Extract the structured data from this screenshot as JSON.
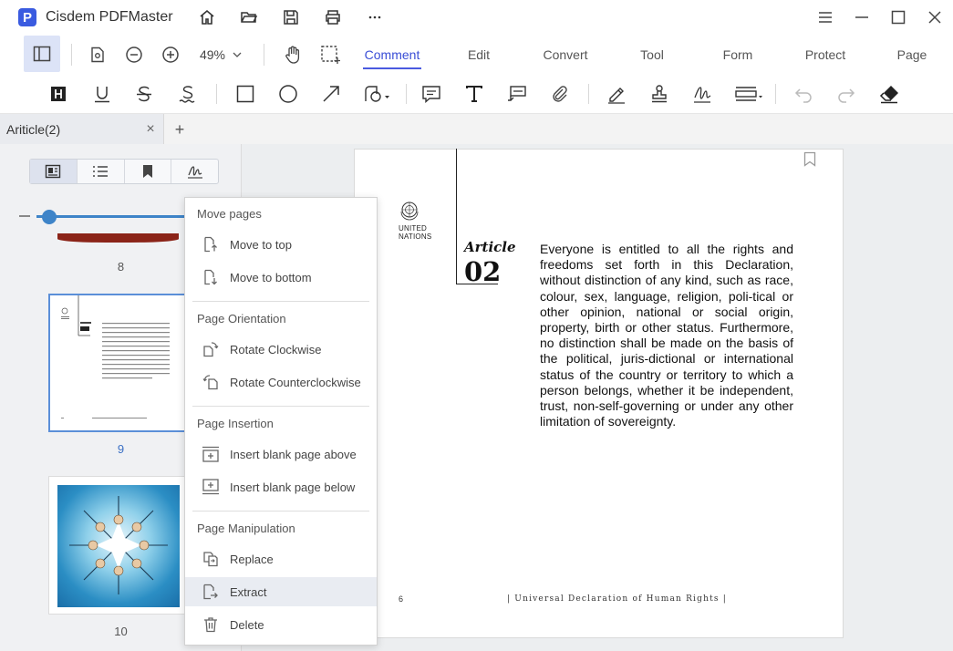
{
  "window": {
    "app_name": "Cisdem PDFMaster",
    "logo_letter": "P"
  },
  "titlebar_icons": [
    "home-icon",
    "open-folder-icon",
    "save-icon",
    "print-icon",
    "more-icon"
  ],
  "toolbar": {
    "zoom": "49%",
    "tabs": [
      {
        "label": "Comment",
        "active": true
      },
      {
        "label": "Edit",
        "active": false
      },
      {
        "label": "Convert",
        "active": false
      },
      {
        "label": "Tool",
        "active": false
      },
      {
        "label": "Form",
        "active": false
      },
      {
        "label": "Protect",
        "active": false
      },
      {
        "label": "Page",
        "active": false
      }
    ]
  },
  "doc_tab": {
    "label": "Ariticle(2)",
    "close": "×",
    "add": "+"
  },
  "thumbnails": {
    "pages": [
      "8",
      "9",
      "10"
    ],
    "active": "9"
  },
  "context_menu": {
    "sections": [
      {
        "title": "Move pages",
        "items": [
          "Move to top",
          "Move to bottom"
        ]
      },
      {
        "title": "Page Orientation",
        "items": [
          "Rotate Clockwise",
          "Rotate Counterclockwise"
        ]
      },
      {
        "title": "Page Insertion",
        "items": [
          "Insert blank page above",
          "Insert blank page below"
        ]
      },
      {
        "title": "Page Manipulation",
        "items": [
          "Replace",
          "Extract",
          "Delete"
        ]
      }
    ],
    "hovered": "Extract"
  },
  "document": {
    "org_line1": "UNITED",
    "org_line2": "NATIONS",
    "article_word": "Article",
    "article_number": "02",
    "article_text": "Everyone is entitled to all the rights and freedoms set forth in this Declaration, without distinction of any kind, such as race, colour, sex, language, religion, poli-tical or other opinion, national or social origin, property, birth or other status. Furthermore, no distinction shall be made on the basis of the political, juris-dictional or international status of the country or territory to which a person belongs, whether it be independent, trust, non-self-governing or under any other limitation of sovereignty.",
    "footer_page": "6",
    "footer_title": "| Universal Declaration of Human Rights |"
  },
  "colors": {
    "accent": "#3a4ed6",
    "slider": "#3e84c8",
    "thumb_border": "#5b8fd8"
  }
}
